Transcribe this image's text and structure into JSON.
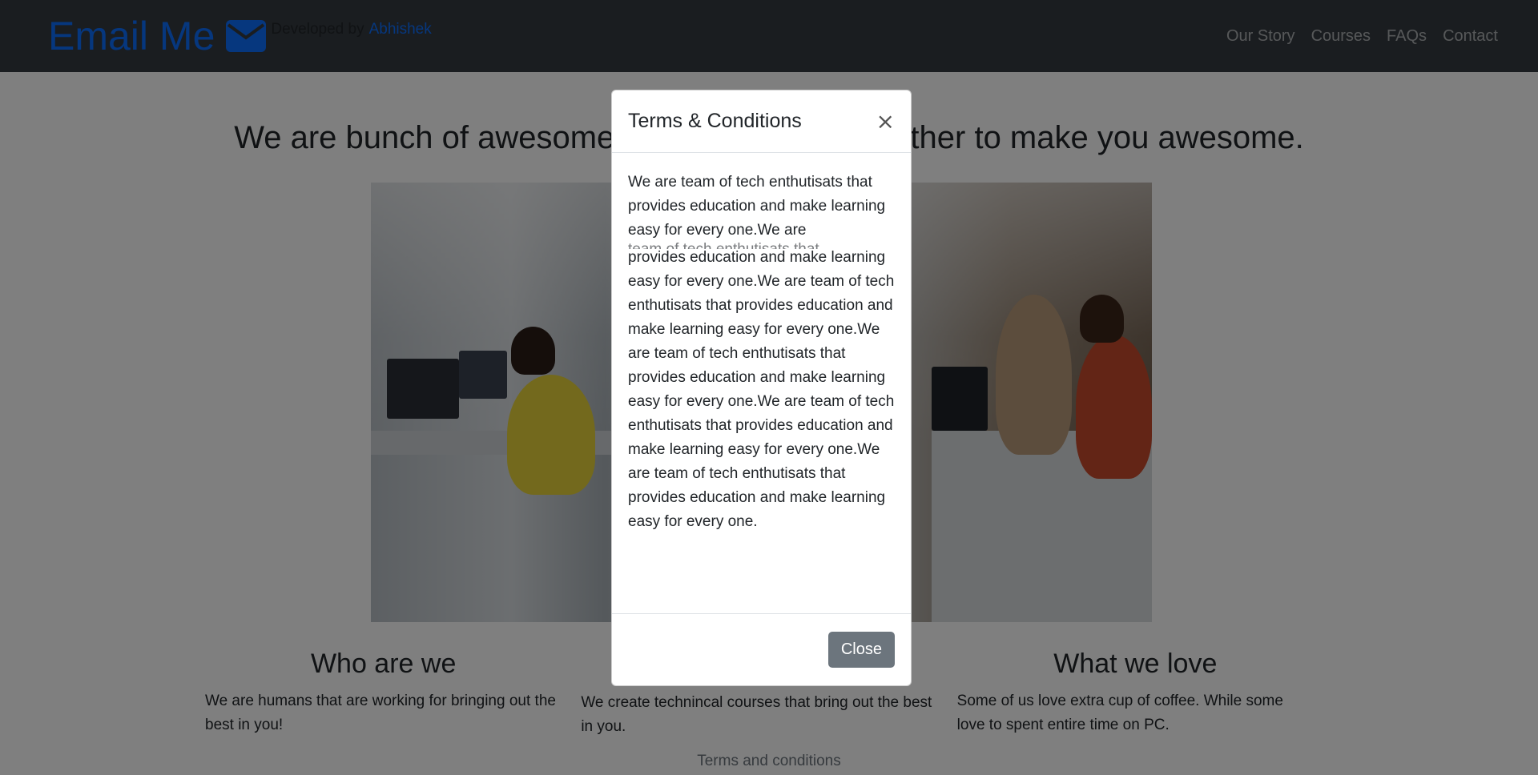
{
  "navbar": {
    "brand": "Email Me",
    "brand_icon": "envelope-icon",
    "developed_by": "Developed by",
    "developer": "Abhishek",
    "links": [
      "Our Story",
      "Courses",
      "FAQs",
      "Contact"
    ]
  },
  "main": {
    "hero_title": "We are bunch of awesome people working together to make you awesome.",
    "features": [
      {
        "title": "Who are we",
        "text": "We are humans that are working for bringing out the best in you!"
      },
      {
        "title": "",
        "text": "We create technincal courses that bring out the best in you."
      },
      {
        "title": "What we love",
        "text": "Some of us love extra cup of coffee. While some love to spent entire time on PC."
      }
    ],
    "footer_link": "Terms and conditions"
  },
  "modal": {
    "title": "Terms & Conditions",
    "close_icon": "×",
    "body_ghost": "team of tech enthutisats that",
    "body_first": "We are team of tech enthutisats that provides education and make learning easy for every one.We are",
    "body_rest": "provides education and make learning easy for every one.We are team of tech enthutisats that provides education and make learning easy for every one.We are team of tech enthutisats that provides education and make learning easy for every one.We are team of tech enthutisats that provides education and make learning easy for every one.We are team of tech enthutisats that provides education and make learning easy for every one.",
    "close_button": "Close"
  },
  "colors": {
    "navbar_bg": "#343a40",
    "brand": "#0d6efd",
    "close_button_bg": "#6c757d",
    "backdrop": "rgba(0,0,0,0.5)"
  }
}
